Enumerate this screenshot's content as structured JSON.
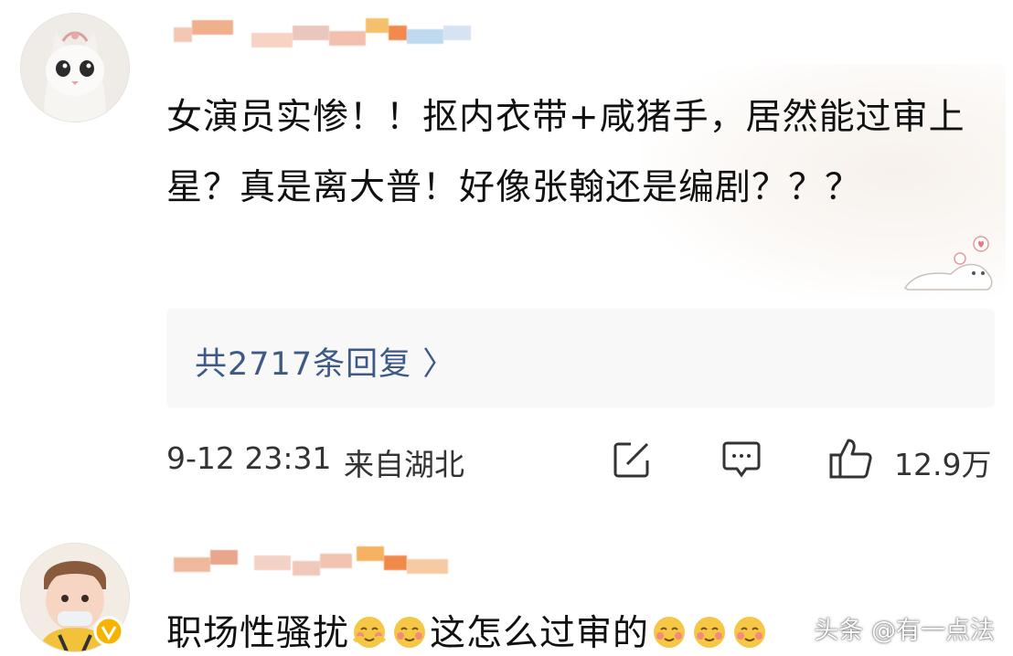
{
  "comment1": {
    "text": "女演员实惨！！抠内衣带+咸猪手，居然能过审上星？真是离大普！好像张翰还是编剧？？？",
    "replies": "共2717条回复 〉",
    "time": "9-12 23:31",
    "location": "来自湖北",
    "likes": "12.9万"
  },
  "comment2": {
    "text_a": "职场性骚扰",
    "text_b": "这怎么过审的"
  },
  "watermark": "头条 @有一点法",
  "icons": {
    "share": "share-icon",
    "comment": "comment-icon",
    "like": "thumbs-up-icon",
    "emoji": "blush-face-emoji"
  },
  "colors": {
    "link": "#3d5a86",
    "text": "#111111",
    "meta": "#333333"
  }
}
